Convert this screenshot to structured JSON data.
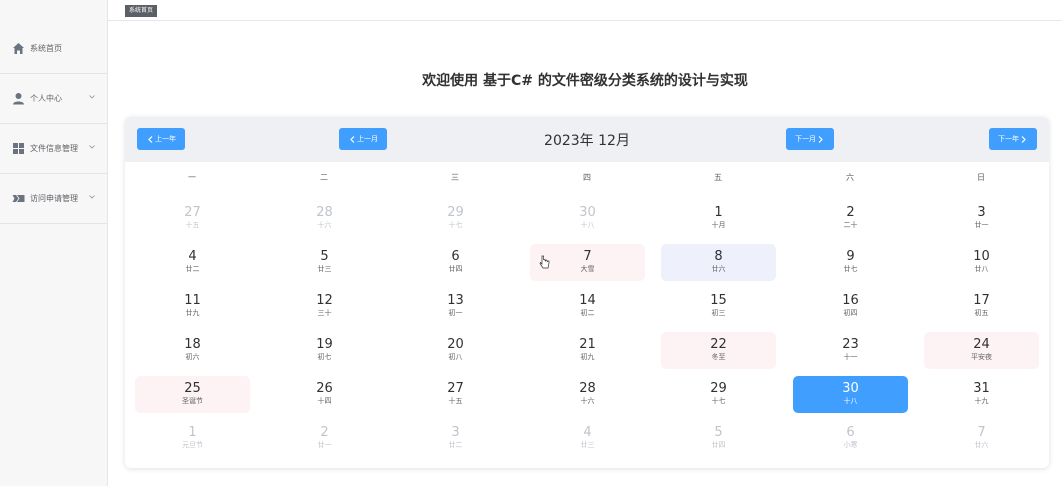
{
  "sidebar": {
    "items": [
      {
        "label": "系统首页",
        "icon": "home-icon"
      },
      {
        "label": "个人中心",
        "icon": "user-icon"
      },
      {
        "label": "文件信息管理",
        "icon": "grid-icon"
      },
      {
        "label": "访问申请管理",
        "icon": "ticket-icon"
      }
    ]
  },
  "tabs": [
    {
      "label": "系统首页"
    }
  ],
  "page": {
    "title": "欢迎使用 基于C# 的文件密级分类系统的设计与实现"
  },
  "calendar": {
    "month_label": "2023年 12月",
    "prev_year": "上一年",
    "prev_month": "上一月",
    "next_month": "下一月",
    "next_year": "下一年",
    "weekdays": [
      "一",
      "二",
      "三",
      "四",
      "五",
      "六",
      "日"
    ],
    "weeks": [
      [
        {
          "n": "27",
          "l": "十五",
          "o": true
        },
        {
          "n": "28",
          "l": "十六",
          "o": true
        },
        {
          "n": "29",
          "l": "十七",
          "o": true
        },
        {
          "n": "30",
          "l": "十八",
          "o": true
        },
        {
          "n": "1",
          "l": "十月"
        },
        {
          "n": "2",
          "l": "二十"
        },
        {
          "n": "3",
          "l": "廿一"
        }
      ],
      [
        {
          "n": "4",
          "l": "廿二"
        },
        {
          "n": "5",
          "l": "廿三"
        },
        {
          "n": "6",
          "l": "廿四"
        },
        {
          "n": "7",
          "l": "大雪",
          "h": true
        },
        {
          "n": "8",
          "l": "廿六",
          "hl": true
        },
        {
          "n": "9",
          "l": "廿七"
        },
        {
          "n": "10",
          "l": "廿八"
        }
      ],
      [
        {
          "n": "11",
          "l": "廿九"
        },
        {
          "n": "12",
          "l": "三十"
        },
        {
          "n": "13",
          "l": "初一"
        },
        {
          "n": "14",
          "l": "初二"
        },
        {
          "n": "15",
          "l": "初三"
        },
        {
          "n": "16",
          "l": "初四"
        },
        {
          "n": "17",
          "l": "初五"
        }
      ],
      [
        {
          "n": "18",
          "l": "初六"
        },
        {
          "n": "19",
          "l": "初七"
        },
        {
          "n": "20",
          "l": "初八"
        },
        {
          "n": "21",
          "l": "初九"
        },
        {
          "n": "22",
          "l": "冬至",
          "h": true
        },
        {
          "n": "23",
          "l": "十一"
        },
        {
          "n": "24",
          "l": "平安夜",
          "h": true
        }
      ],
      [
        {
          "n": "25",
          "l": "圣诞节",
          "h": true
        },
        {
          "n": "26",
          "l": "十四"
        },
        {
          "n": "27",
          "l": "十五"
        },
        {
          "n": "28",
          "l": "十六"
        },
        {
          "n": "29",
          "l": "十七"
        },
        {
          "n": "30",
          "l": "十八",
          "s": true
        },
        {
          "n": "31",
          "l": "十九"
        }
      ],
      [
        {
          "n": "1",
          "l": "元旦节",
          "o": true
        },
        {
          "n": "2",
          "l": "廿一",
          "o": true
        },
        {
          "n": "3",
          "l": "廿二",
          "o": true
        },
        {
          "n": "4",
          "l": "廿三",
          "o": true
        },
        {
          "n": "5",
          "l": "廿四",
          "o": true
        },
        {
          "n": "6",
          "l": "小寒",
          "o": true
        },
        {
          "n": "7",
          "l": "廿六",
          "o": true
        }
      ]
    ]
  },
  "colors": {
    "accent": "#409eff",
    "holiday_bg": "#fdf2f4",
    "highlight_bg": "#eef1fb",
    "sidebar_bg": "#f7f7f8",
    "tab_bg": "#5b5f66"
  }
}
